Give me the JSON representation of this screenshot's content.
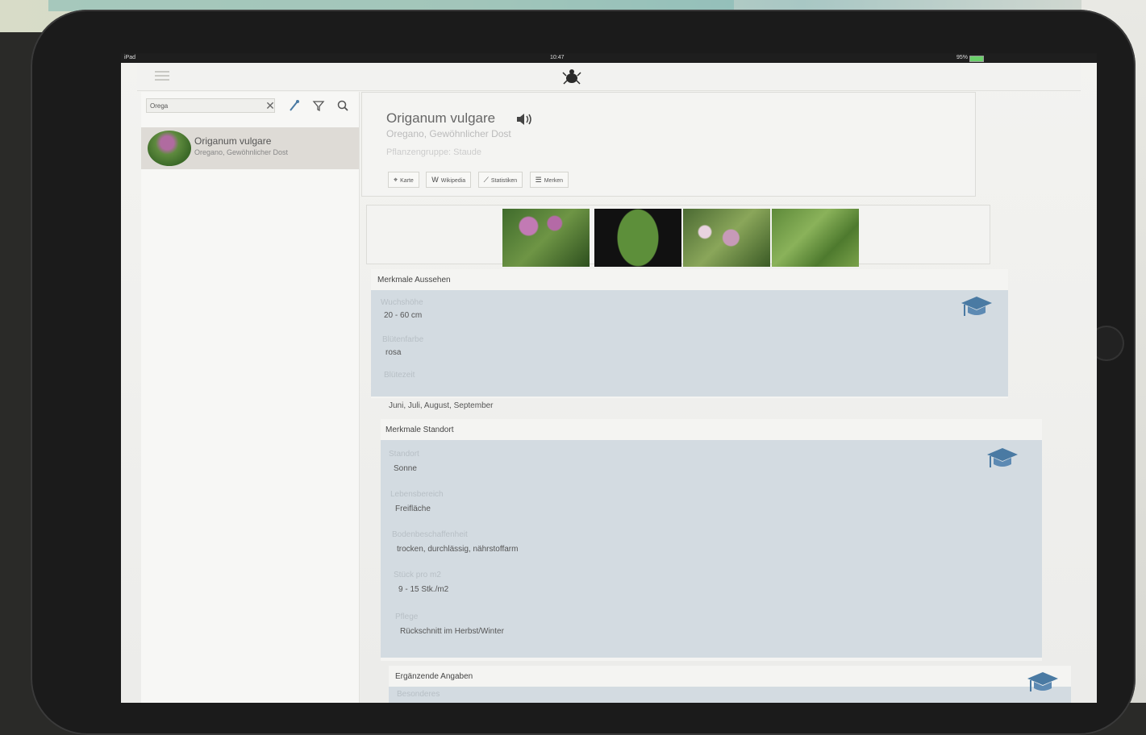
{
  "status_bar": {
    "device": "iPad",
    "time": "10:47",
    "battery": "95%"
  },
  "search": {
    "value": "Orega"
  },
  "results": [
    {
      "title": "Origanum vulgare",
      "subtitle": "Oregano, Gewöhnlicher Dost"
    }
  ],
  "detail": {
    "name": "Origanum vulgare",
    "common": "Oregano, Gewöhnlicher Dost",
    "group": "Pflanzengruppe: Staude",
    "buttons": {
      "map": "Karte",
      "wiki": "Wikipedia",
      "stats": "Statistiken",
      "notes": "Merken"
    }
  },
  "sections": {
    "appearance": {
      "title": "Merkmale Aussehen",
      "fields": [
        {
          "label": "Wuchshöhe",
          "value": "20 - 60 cm"
        },
        {
          "label": "Blütenfarbe",
          "value": "rosa"
        },
        {
          "label": "Blütezeit",
          "value": "Juni, Juli, August, September"
        }
      ]
    },
    "location": {
      "title": "Merkmale Standort",
      "fields": [
        {
          "label": "Standort",
          "value": "Sonne"
        },
        {
          "label": "Lebensbereich",
          "value": "Freifläche"
        },
        {
          "label": "Bodenbeschaffenheit",
          "value": "trocken, durchlässig, nährstoffarm"
        },
        {
          "label": "Stück pro m2",
          "value": "9 - 15 Stk./m2"
        },
        {
          "label": "Pflege",
          "value": "Rückschnitt im Herbst/Winter"
        }
      ]
    },
    "extra": {
      "title": "Ergänzende Angaben",
      "fields": [
        {
          "label": "Besonderes"
        }
      ]
    }
  },
  "colors": {
    "panel_blue": "#d3dbe1",
    "accent_icon": "#4a7aa3"
  }
}
